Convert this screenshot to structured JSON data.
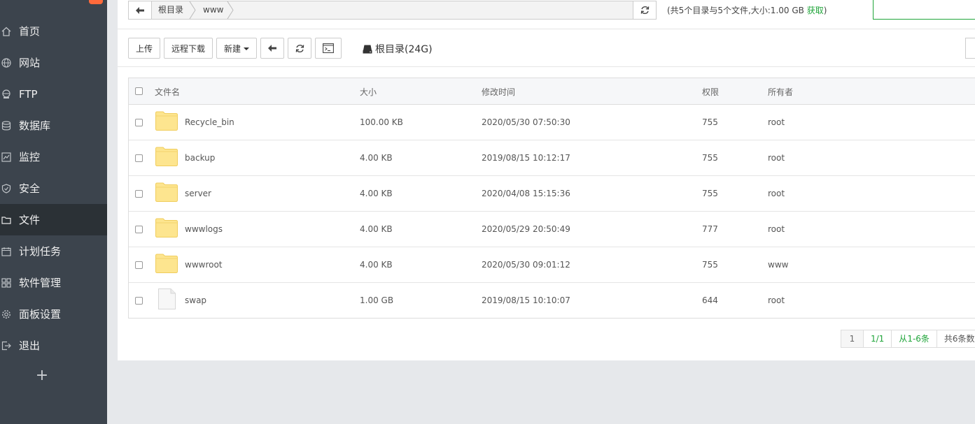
{
  "sidebar": {
    "items": [
      {
        "label": "首页",
        "icon": "home-icon",
        "active": false
      },
      {
        "label": "网站",
        "icon": "globe-icon",
        "active": false
      },
      {
        "label": "FTP",
        "icon": "ftp-icon",
        "active": false
      },
      {
        "label": "数据库",
        "icon": "database-icon",
        "active": false
      },
      {
        "label": "监控",
        "icon": "monitor-icon",
        "active": false
      },
      {
        "label": "安全",
        "icon": "shield-icon",
        "active": false
      },
      {
        "label": "文件",
        "icon": "folder-icon",
        "active": true
      },
      {
        "label": "计划任务",
        "icon": "calendar-icon",
        "active": false
      },
      {
        "label": "软件管理",
        "icon": "grid-icon",
        "active": false
      },
      {
        "label": "面板设置",
        "icon": "gear-icon",
        "active": false
      },
      {
        "label": "退出",
        "icon": "logout-icon",
        "active": false
      }
    ],
    "add_label": "+"
  },
  "pathbar": {
    "crumbs": [
      "根目录",
      "www"
    ]
  },
  "summary": {
    "text": "(共5个目录与5个文件,大小:1.00 GB ",
    "link": "获取",
    "close": ")"
  },
  "toolbar": {
    "upload": "上传",
    "remote_download": "远程下载",
    "new": "新建",
    "disk_label": "根目录(24G)"
  },
  "table": {
    "headers": {
      "name": "文件名",
      "size": "大小",
      "mtime": "修改时间",
      "perm": "权限",
      "owner": "所有者"
    },
    "rows": [
      {
        "name": "Recycle_bin",
        "type": "folder",
        "size": "100.00 KB",
        "mtime": "2020/05/30 07:50:30",
        "perm": "755",
        "owner": "root"
      },
      {
        "name": "backup",
        "type": "folder",
        "size": "4.00 KB",
        "mtime": "2019/08/15 10:12:17",
        "perm": "755",
        "owner": "root"
      },
      {
        "name": "server",
        "type": "folder",
        "size": "4.00 KB",
        "mtime": "2020/04/08 15:15:36",
        "perm": "755",
        "owner": "root"
      },
      {
        "name": "wwwlogs",
        "type": "folder",
        "size": "4.00 KB",
        "mtime": "2020/05/29 20:50:49",
        "perm": "777",
        "owner": "root"
      },
      {
        "name": "wwwroot",
        "type": "folder",
        "size": "4.00 KB",
        "mtime": "2020/05/30 09:01:12",
        "perm": "755",
        "owner": "www"
      },
      {
        "name": "swap",
        "type": "file",
        "size": "1.00 GB",
        "mtime": "2019/08/15 10:10:07",
        "perm": "644",
        "owner": "root"
      }
    ]
  },
  "pager": {
    "page": "1",
    "pages": "1/1",
    "range": "从1-6条",
    "total": "共6条数"
  },
  "colors": {
    "accent": "#20a53a",
    "sidebar_bg": "#3c444d",
    "sidebar_active": "#2b3136",
    "folder": "#fde58f"
  }
}
